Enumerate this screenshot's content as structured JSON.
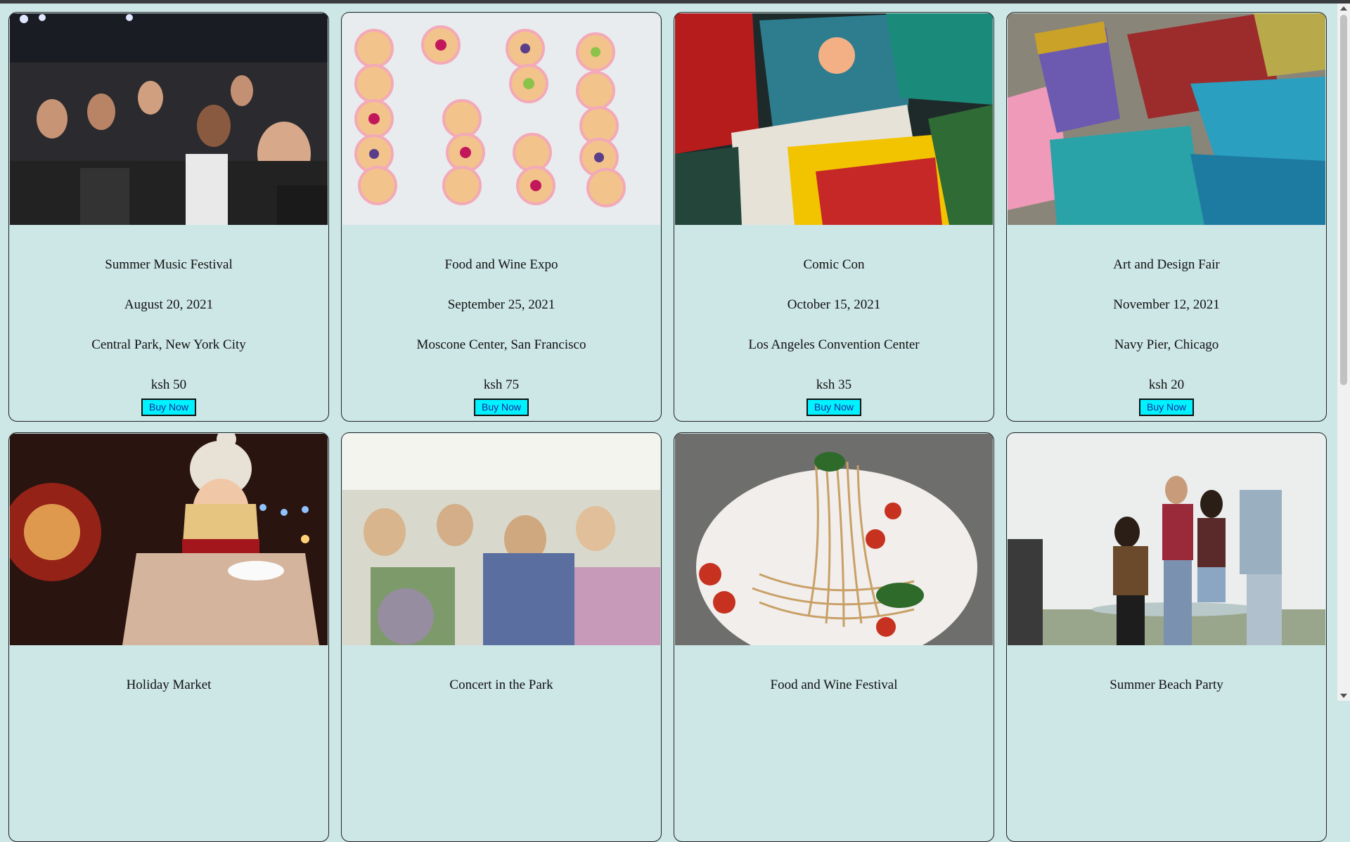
{
  "events": [
    {
      "title": "Summer Music Festival",
      "date": "August 20, 2021",
      "location": "Central Park, New York City",
      "price": "ksh 50",
      "button": "Buy Now",
      "image": "concert-crowd-photo"
    },
    {
      "title": "Food and Wine Expo",
      "date": "September 25, 2021",
      "location": "Moscone Center, San Francisco",
      "price": "ksh 75",
      "button": "Buy Now",
      "image": "fruit-tarts-photo"
    },
    {
      "title": "Comic Con",
      "date": "October 15, 2021",
      "location": "Los Angeles Convention Center",
      "price": "ksh 35",
      "button": "Buy Now",
      "image": "comic-books-photo"
    },
    {
      "title": "Art and Design Fair",
      "date": "November 12, 2021",
      "location": "Navy Pier, Chicago",
      "price": "ksh 20",
      "button": "Buy Now",
      "image": "paint-brushes-photo"
    },
    {
      "title": "Holiday Market",
      "image": "holiday-market-photo"
    },
    {
      "title": "Concert in the Park",
      "image": "dancing-crowd-photo"
    },
    {
      "title": "Food and Wine Festival",
      "image": "pasta-plate-photo"
    },
    {
      "title": "Summer Beach Party",
      "image": "beach-party-photo"
    }
  ],
  "colors": {
    "page_bg": "#cde6e6",
    "button_bg": "#00f2ff",
    "button_text": "#1b2a9a"
  }
}
